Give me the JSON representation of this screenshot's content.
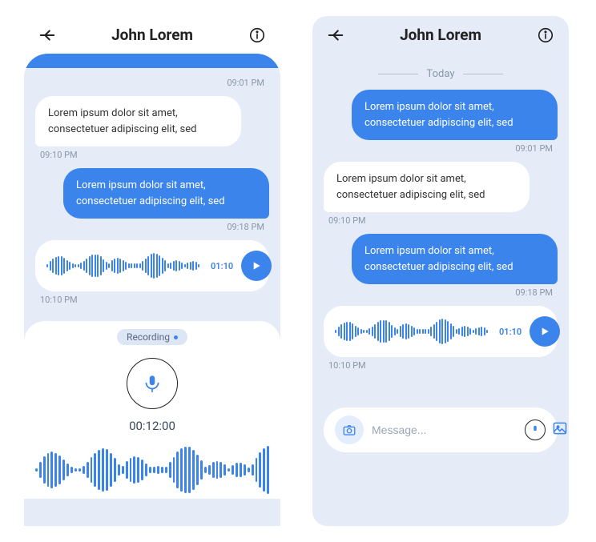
{
  "left": {
    "header": {
      "title": "John Lorem"
    },
    "peek_time": "09:01 PM",
    "m1": {
      "text": "Lorem ipsum dolor sit amet, consectetuer adipiscing elit, sed",
      "time": "09:10 PM"
    },
    "m2": {
      "text": "Lorem ipsum dolor sit amet, consectetuer adipiscing elit, sed",
      "time": "09:18 PM"
    },
    "voice": {
      "duration": "01:10",
      "time": "10:10 PM"
    },
    "recording": {
      "label": "Recording",
      "elapsed": "00:12:00"
    }
  },
  "right": {
    "header": {
      "title": "John Lorem"
    },
    "today": "Today",
    "m1": {
      "text": "Lorem ipsum dolor sit amet, consectetuer adipiscing elit, sed",
      "time": "09:01 PM"
    },
    "m2": {
      "text": "Lorem ipsum dolor sit amet, consectetuer adipiscing elit, sed",
      "time": "09:10 PM"
    },
    "m3": {
      "text": "Lorem ipsum dolor sit amet, consectetuer adipiscing elit, sed",
      "time": "09:18 PM"
    },
    "voice": {
      "duration": "01:10",
      "time": "10:10 PM"
    },
    "composer": {
      "placeholder": "Message..."
    }
  }
}
